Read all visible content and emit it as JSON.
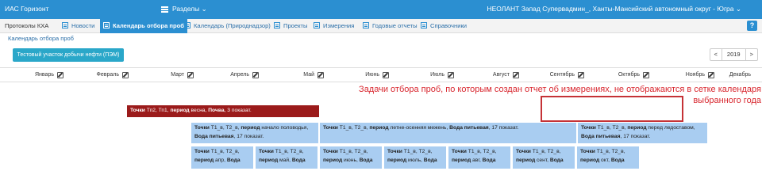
{
  "header": {
    "app_title": "ИАС Горизонт",
    "sections_label": "Разделы",
    "user_info": "НЕОЛАНТ Запад Супервадмин_, Ханты-Мансийский автономный округ - Югра"
  },
  "tabs": [
    {
      "label": "Протоколы КХА"
    },
    {
      "label": "Новости"
    },
    {
      "label": "Календарь отбора проб"
    },
    {
      "label": "Календарь (Природнадзор)"
    },
    {
      "label": "Проекты"
    },
    {
      "label": "Измерения"
    },
    {
      "label": "Годовые отчеты"
    },
    {
      "label": "Справочники"
    }
  ],
  "help_label": "?",
  "breadcrumb": "Календарь отбора проб",
  "site_button": "Тестовый участок добычи нефти (ПЭМ)",
  "year": {
    "prev": "<",
    "value": "2019",
    "next": ">"
  },
  "months": [
    "Январь",
    "Февраль",
    "Март",
    "Апрель",
    "Май",
    "Июнь",
    "Июль",
    "Август",
    "Сентябрь",
    "Октябрь",
    "Ноябрь",
    "Декабрь"
  ],
  "annotation": "Задачи отбора проб, по которым создан отчет об измерениях, не  отображаются в сетке календаря выбранного года",
  "events": {
    "e0": {
      "a": "Точки",
      "b": " Тп2, Тп1, ",
      "c": "период",
      "d": " весна, ",
      "e": "Почва",
      "f": ", 3 показат."
    },
    "e1": {
      "a": "Точки",
      "b": " Т1_в, Т2_в, ",
      "c": "период",
      "d": " начало половодья, ",
      "e": "Вода питьевая",
      "f": ", 17 показат."
    },
    "e2": {
      "a": "Точки",
      "b": " Т1_в, Т2_в, ",
      "c": "период",
      "d": " летне-осенняя межень, ",
      "e": "Вода питьевая",
      "f": ", 17 показат."
    },
    "e3": {
      "a": "Точки",
      "b": " Т1_в, Т2_в, ",
      "c": "период",
      "d": " перед ледоставом, ",
      "e": "Вода питьевая",
      "f": ", 17 показат."
    },
    "e4": {
      "a": "Точки",
      "b": " Т1_в, Т2_в, ",
      "c": "период",
      "d": " апр, ",
      "e": "Вода",
      "f": ""
    },
    "e5": {
      "a": "Точки",
      "b": " Т1_в, Т2_в, ",
      "c": "период",
      "d": " май, ",
      "e": "Вода",
      "f": ""
    },
    "e6": {
      "a": "Точки",
      "b": " Т1_в, Т2_в, ",
      "c": "период",
      "d": " июнь, ",
      "e": "Вода",
      "f": ""
    },
    "e7": {
      "a": "Точки",
      "b": " Т1_в, Т2_в, ",
      "c": "период",
      "d": " июль, ",
      "e": "Вода",
      "f": ""
    },
    "e8": {
      "a": "Точки",
      "b": " Т1_в, Т2_в, ",
      "c": "период",
      "d": " авг, ",
      "e": "Вода",
      "f": ""
    },
    "e9": {
      "a": "Точки",
      "b": " Т1_в, Т2_в, ",
      "c": "период",
      "d": " сент, ",
      "e": "Вода",
      "f": ""
    },
    "e10": {
      "a": "Точки",
      "b": " Т1_в, Т2_в, ",
      "c": "период",
      "d": " окт, ",
      "e": "Вода",
      "f": ""
    }
  },
  "colors": {
    "primary": "#2b8fd1",
    "event_light": "#a9cdf1",
    "event_dark": "#9b1b1b",
    "annotation": "#d8262e"
  }
}
